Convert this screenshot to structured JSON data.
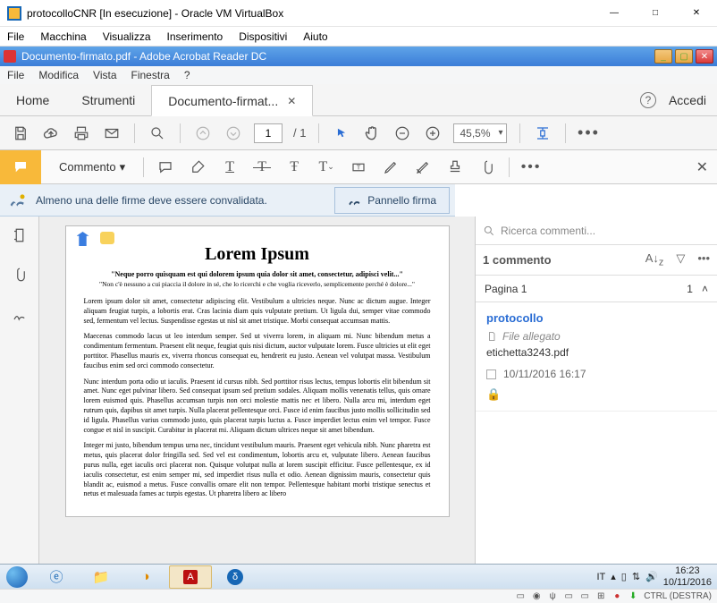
{
  "vb": {
    "title": "protocolloCNR [In esecuzione] - Oracle VM VirtualBox",
    "menu": {
      "file": "File",
      "macchina": "Macchina",
      "visualizza": "Visualizza",
      "inserimento": "Inserimento",
      "dispositivi": "Dispositivi",
      "aiuto": "Aiuto"
    },
    "status_ctrl": "CTRL (DESTRA)"
  },
  "reader": {
    "title": "Documento-firmato.pdf - Adobe Acrobat Reader DC",
    "menu": {
      "file": "File",
      "modifica": "Modifica",
      "vista": "Vista",
      "finestra": "Finestra",
      "help": "?"
    }
  },
  "tabs": {
    "home": "Home",
    "strumenti": "Strumenti",
    "doc": "Documento-firmat...",
    "accedi": "Accedi"
  },
  "toolbar": {
    "page_current": "1",
    "page_total": "/ 1",
    "zoom": "45,5%"
  },
  "ctoolbar": {
    "commento": "Commento"
  },
  "signbar": {
    "msg": "Almeno una delle firme deve essere convalidata.",
    "btn": "Pannello firma"
  },
  "doc": {
    "title": "Lorem Ipsum",
    "sub1": "\"Neque porro quisquam est qui dolorem ipsum quia dolor sit amet, consectetur, adipisci velit...\"",
    "sub2": "\"Non c'è nessuno a cui piaccia il dolore in sé, che lo ricerchi e che voglia riceverlo, semplicemente perché è dolore...\"",
    "p1": "Lorem ipsum dolor sit amet, consectetur adipiscing elit. Vestibulum a ultricies neque. Nunc ac dictum augue. Integer aliquam feugiat turpis, a lobortis erat. Cras lacinia diam quis vulputate pretium. Ut ligula dui, semper vitae commodo sed, fermentum vel lectus. Suspendisse egestas ut nisl sit amet tristique. Morbi consequat accumsan mattis.",
    "p2": "Maecenas commodo lacus ut leo interdum semper. Sed ut viverra lorem, in aliquam mi. Nunc bibendum metus a condimentum fermentum. Praesent elit neque, feugiat quis nisi dictum, auctor vulputate lorem. Fusce ultricies ut elit eget porttitor. Phasellus mauris ex, viverra rhoncus consequat eu, hendrerit eu justo. Aenean vel volutpat massa. Vestibulum faucibus enim sed orci commodo consectetur.",
    "p3": "Nunc interdum porta odio ut iaculis. Praesent id cursus nibh. Sed porttitor risus lectus, tempus lobortis elit bibendum sit amet. Nunc eget pulvinar libero. Sed consequat ipsum sed pretium sodales. Aliquam mollis venenatis tellus, quis ornare lorem euismod quis. Phasellus accumsan turpis non orci molestie mattis nec et libero. Nulla arcu mi, interdum eget rutrum quis, dapibus sit amet turpis. Nulla placerat pellentesque orci. Fusce id enim faucibus justo mollis sollicitudin sed id ligula. Phasellus varius commodo justo, quis placerat turpis luctus a. Fusce imperdiet lectus enim vel tempor. Fusce congue et nisl in suscipit. Curabitur in placerat mi. Aliquam dictum ultrices neque sit amet bibendum.",
    "p4": "Integer mi justo, bibendum tempus urna nec, tincidunt vestibulum mauris. Praesent eget vehicula nibh. Nunc pharetra est metus, quis placerat dolor fringilla sed. Sed vel est condimentum, lobortis arcu et, vulputate libero. Aenean faucibus purus nulla, eget iaculis orci placerat non. Quisque volutpat nulla at lorem suscipit efficitur. Fusce pellentesque, ex id iaculis consectetur, est enim semper mi, sed imperdiet risus nulla et odio. Aenean dignissim mauris, consectetur quis blandit ac, euismod a metus. Fusce convallis ornare elit non tempor. Pellentesque habitant morbi tristique senectus et netus et malesuada fames ac turpis egestas. Ut pharetra libero ac libero"
  },
  "comments": {
    "search_ph": "Ricerca commenti...",
    "count": "1 commento",
    "page_label": "Pagina 1",
    "page_count": "1",
    "item": {
      "author": "protocollo",
      "attach_label": "File allegato",
      "filename": "etichetta3243.pdf",
      "date": "10/11/2016  16:17"
    }
  },
  "taskbar": {
    "lang": "IT",
    "time": "16:23",
    "date": "10/11/2016"
  }
}
